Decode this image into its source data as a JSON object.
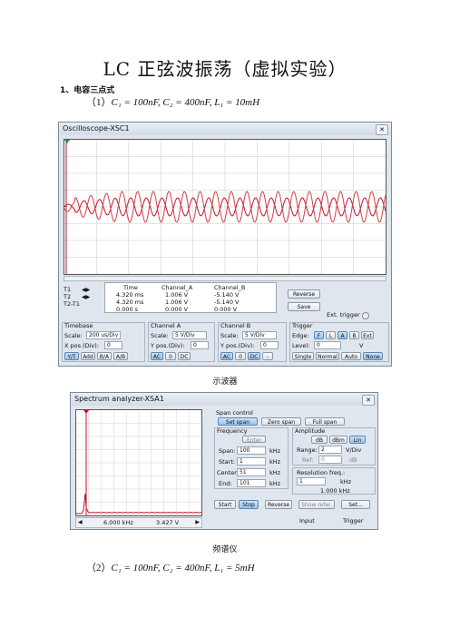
{
  "doc": {
    "title": "LC 正弦波振荡（虚拟实验）",
    "section": "1、电容三点式",
    "formula1_prefix": "（1）",
    "formula1": "C₁ = 100nF, C₂ = 400nF, L₁ = 10mH",
    "caption1": "示波器",
    "caption2": "频谱仪",
    "formula2_prefix": "（2）",
    "formula2": "C₁ = 100nF, C₂ = 400nF, L₁ = 5mH"
  },
  "oscilloscope": {
    "window_title": "Oscilloscope-XSC1",
    "trace_colors": {
      "a": "#c8102e",
      "b": "#c8102e"
    },
    "readout": {
      "header": [
        "Time",
        "Channel_A",
        "Channel_B"
      ],
      "rows": [
        {
          "label": "T1",
          "time": "4.320 ms",
          "a": "1.006 V",
          "b": "-5.140 V"
        },
        {
          "label": "T2",
          "time": "4.320 ms",
          "a": "1.006 V",
          "b": "-5.140 V"
        },
        {
          "label": "T2-T1",
          "time": "0.000 s",
          "a": "0.000 V",
          "b": "0.000 V"
        }
      ]
    },
    "reverse_label": "Reverse",
    "save_label": "Save",
    "ext_trigger_label": "Ext. trigger",
    "timebase": {
      "title": "Timebase",
      "scale_label": "Scale:",
      "scale": "200 us/Div",
      "xpos_label": "X pos.(Div):",
      "xpos": "0",
      "buttons": [
        "Y/T",
        "Add",
        "B/A",
        "A/B"
      ]
    },
    "channel_a": {
      "title": "Channel A",
      "scale_label": "Scale:",
      "scale": "5 V/Div",
      "ypos_label": "Y pos.(Div):",
      "ypos": "0",
      "buttons": [
        "AC",
        "0",
        "DC"
      ]
    },
    "channel_b": {
      "title": "Channel B",
      "scale_label": "Scale:",
      "scale": "5 V/Div",
      "ypos_label": "Y pos.(Div):",
      "ypos": "0",
      "buttons": [
        "AC",
        "0",
        "DC",
        "-"
      ]
    },
    "trigger": {
      "title": "Trigger",
      "edge_label": "Edge:",
      "edge_buttons": [
        "F",
        "L",
        "A",
        "B",
        "Ext"
      ],
      "level_label": "Level:",
      "level": "0",
      "level_unit": "V",
      "mode_buttons": [
        "Single",
        "Normal",
        "Auto",
        "None"
      ]
    }
  },
  "spectrum": {
    "window_title": "Spectrum analyzer-XSA1",
    "span_control": {
      "title": "Span control",
      "buttons": [
        "Set span",
        "Zero span",
        "Full span"
      ]
    },
    "frequency": {
      "title": "Frequency",
      "enter_label": "Enter",
      "span_label": "Span:",
      "span": "100",
      "start_label": "Start:",
      "start": "1",
      "center_label": "Center:",
      "center": "51",
      "end_label": "End:",
      "end": "101",
      "unit": "kHz"
    },
    "amplitude": {
      "title": "Amplitude",
      "buttons": [
        "dB",
        "dBm",
        "Lin"
      ],
      "range_label": "Range:",
      "range": "2",
      "range_unit": "V/Div",
      "ref_label": "Ref:",
      "ref": "0",
      "ref_unit": "dB"
    },
    "resolution": {
      "title": "Resolution freq.:",
      "value": "1",
      "unit": "kHz",
      "readout": "1.000 kHz"
    },
    "bottom_buttons": [
      "Start",
      "Stop",
      "Reverse",
      "Show refer.",
      "Set..."
    ],
    "readout_freq": "6.000 kHz",
    "readout_amp": "3.427 V",
    "input_label": "Input",
    "trigger_label": "Trigger"
  }
}
